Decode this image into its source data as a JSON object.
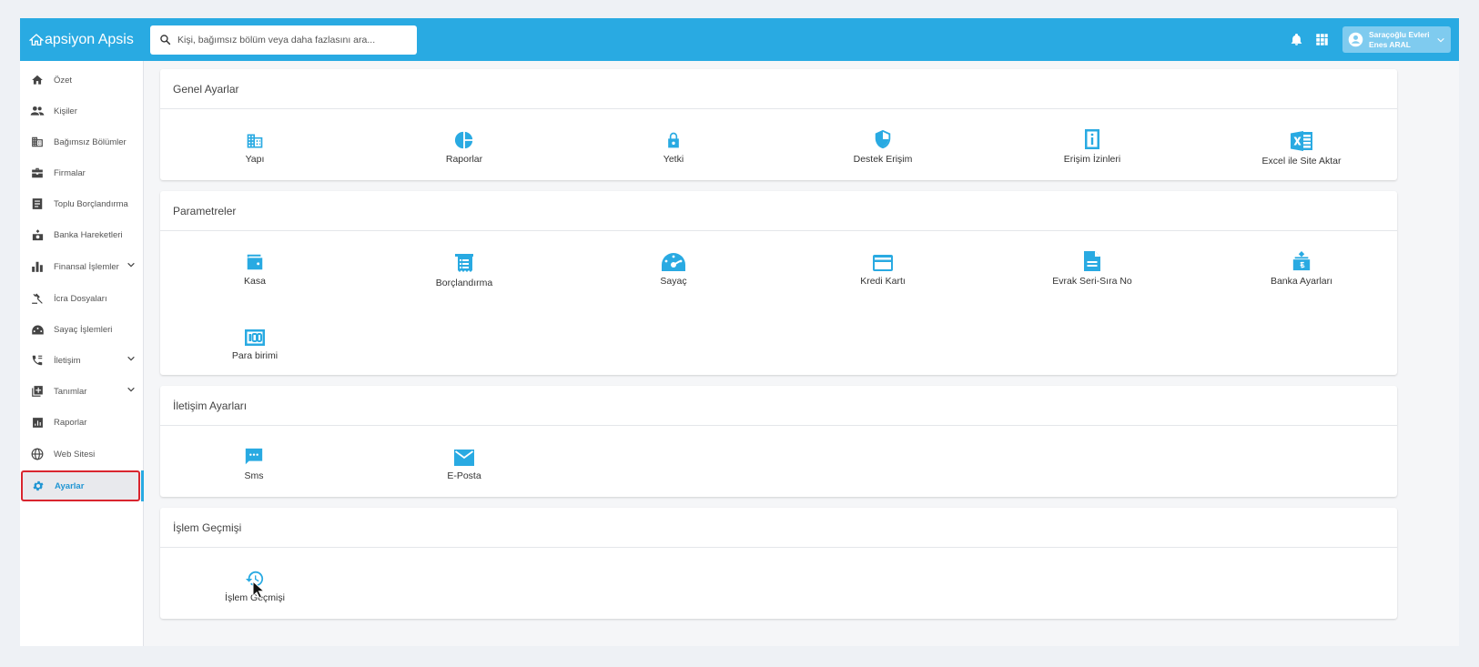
{
  "brand": {
    "name": "apsiyon Apsis",
    "color": "#29aae2"
  },
  "search": {
    "placeholder": "Kişi, bağımsız bölüm veya daha fazlasını ara..."
  },
  "user": {
    "site": "Saraçoğlu Evleri",
    "name": "Enes ARAL"
  },
  "sidebar": {
    "items": [
      {
        "label": "Özet",
        "icon": "home-icon"
      },
      {
        "label": "Kişiler",
        "icon": "people-icon"
      },
      {
        "label": "Bağımsız Bölümler",
        "icon": "building-icon"
      },
      {
        "label": "Firmalar",
        "icon": "briefcase-icon"
      },
      {
        "label": "Toplu Borçlandırma",
        "icon": "receipt-icon"
      },
      {
        "label": "Banka Hareketleri",
        "icon": "bank-icon"
      },
      {
        "label": "Finansal İşlemler",
        "icon": "bar-chart-icon",
        "expandable": true
      },
      {
        "label": "İcra Dosyaları",
        "icon": "gavel-icon"
      },
      {
        "label": "Sayaç İşlemleri",
        "icon": "meter-icon"
      },
      {
        "label": "İletişim",
        "icon": "phone-icon",
        "expandable": true
      },
      {
        "label": "Tanımlar",
        "icon": "add-box-icon",
        "expandable": true
      },
      {
        "label": "Raporlar",
        "icon": "report-icon"
      },
      {
        "label": "Web Sitesi",
        "icon": "globe-icon"
      },
      {
        "label": "Ayarlar",
        "icon": "gear-icon",
        "active": true
      }
    ]
  },
  "sections": [
    {
      "title": "Genel Ayarlar",
      "tiles": [
        {
          "label": "Yapı",
          "icon": "building-icon"
        },
        {
          "label": "Raporlar",
          "icon": "pie-chart-icon"
        },
        {
          "label": "Yetki",
          "icon": "lock-icon"
        },
        {
          "label": "Destek Erişim",
          "icon": "shield-icon"
        },
        {
          "label": "Erişim İzinleri",
          "icon": "info-card-icon"
        },
        {
          "label": "Excel ile Site Aktar",
          "icon": "excel-icon"
        }
      ]
    },
    {
      "title": "Parametreler",
      "tiles": [
        {
          "label": "Kasa",
          "icon": "wallet-icon"
        },
        {
          "label": "Borçlandırma",
          "icon": "receipt-icon"
        },
        {
          "label": "Sayaç",
          "icon": "gauge-icon"
        },
        {
          "label": "Kredi Kartı",
          "icon": "credit-card-icon"
        },
        {
          "label": "Evrak Seri-Sıra No",
          "icon": "document-icon"
        },
        {
          "label": "Banka Ayarları",
          "icon": "bank-icon"
        },
        {
          "label": "Para birimi",
          "icon": "currency-icon"
        }
      ]
    },
    {
      "title": "İletişim Ayarları",
      "tiles": [
        {
          "label": "Sms",
          "icon": "sms-icon"
        },
        {
          "label": "E-Posta",
          "icon": "mail-icon"
        }
      ]
    },
    {
      "title": "İşlem Geçmişi",
      "tiles": [
        {
          "label": "İşlem Geçmişi",
          "icon": "history-icon"
        }
      ]
    }
  ]
}
